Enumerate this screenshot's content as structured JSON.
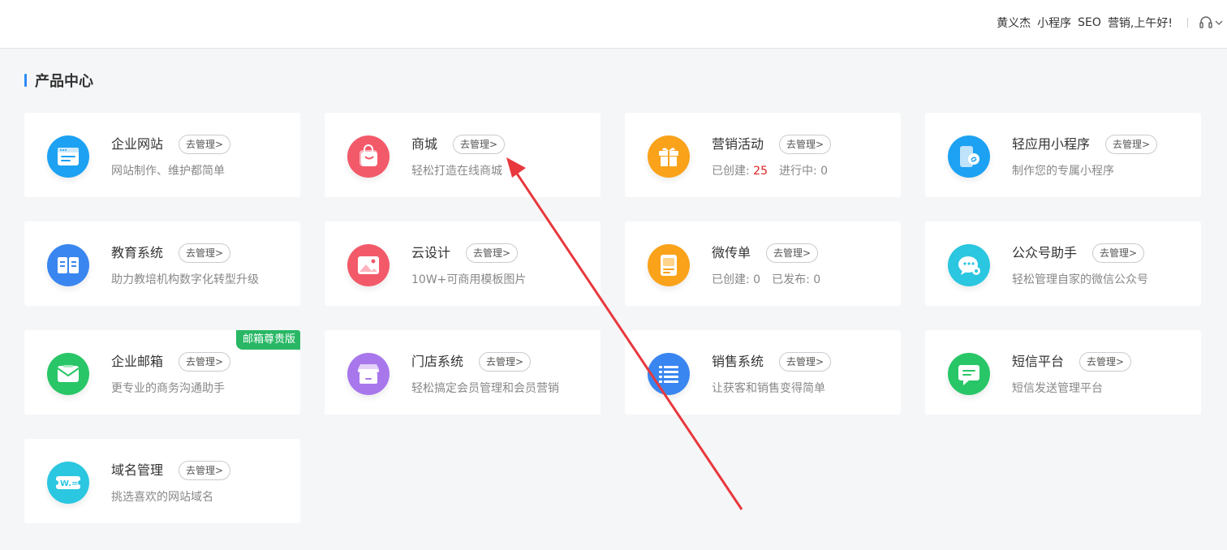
{
  "topbar": {
    "user_name": "黄义杰",
    "mini_program": "小程序",
    "seo": "SEO",
    "greeting": "营销,上午好!",
    "support_icon": "headset-icon",
    "dropdown_icon": "chevron-down-icon"
  },
  "section": {
    "title": "产品中心"
  },
  "manage_label": "去管理>",
  "products": [
    {
      "id": "website",
      "name": "企业网站",
      "desc": "网站制作、维护都简单",
      "icon": "browser-window-icon",
      "color": "#1da1f2"
    },
    {
      "id": "mall",
      "name": "商城",
      "desc": "轻松打造在线商城",
      "icon": "shopping-bag-icon",
      "color": "#f25a6a"
    },
    {
      "id": "marketing",
      "name": "营销活动",
      "desc_created_label": "已创建:",
      "desc_created_value": "25",
      "desc_progress_label": "进行中:",
      "desc_progress_value": "0",
      "icon": "gift-icon",
      "color": "#f9a21a"
    },
    {
      "id": "lite-app",
      "name": "轻应用小程序",
      "desc": "制作您的专属小程序",
      "icon": "mini-program-icon",
      "color": "#1da1f2"
    },
    {
      "id": "education",
      "name": "教育系统",
      "desc": "助力教培机构数字化转型升级",
      "icon": "book-icon",
      "color": "#3a86f0"
    },
    {
      "id": "cloud-design",
      "name": "云设计",
      "desc": "10W+可商用模板图片",
      "icon": "image-icon",
      "color": "#f25a6a"
    },
    {
      "id": "flyer",
      "name": "微传单",
      "desc_created_label": "已创建:",
      "desc_created_value": "0",
      "desc_published_label": "已发布:",
      "desc_published_value": "0",
      "icon": "flyer-icon",
      "color": "#f9a21a"
    },
    {
      "id": "wechat-assistant",
      "name": "公众号助手",
      "desc": "轻松管理自家的微信公众号",
      "icon": "wechat-chat-icon",
      "color": "#2bc6e0"
    },
    {
      "id": "email",
      "name": "企业邮箱",
      "desc": "更专业的商务沟通助手",
      "badge": "邮箱尊贵版",
      "icon": "envelope-icon",
      "color": "#29c667"
    },
    {
      "id": "store",
      "name": "门店系统",
      "desc": "轻松搞定会员管理和会员营销",
      "icon": "storefront-icon",
      "color": "#a877ec"
    },
    {
      "id": "sales",
      "name": "销售系统",
      "desc": "让获客和销售变得简单",
      "icon": "list-icon",
      "color": "#3a86f0"
    },
    {
      "id": "sms",
      "name": "短信平台",
      "desc": "短信发送管理平台",
      "icon": "message-icon",
      "color": "#29c667"
    },
    {
      "id": "domain",
      "name": "域名管理",
      "desc": "挑选喜欢的网站域名",
      "icon": "domain-ticket-icon",
      "color": "#2bc6e0"
    }
  ],
  "annotation": {
    "icon": "red-arrow-annotation"
  }
}
